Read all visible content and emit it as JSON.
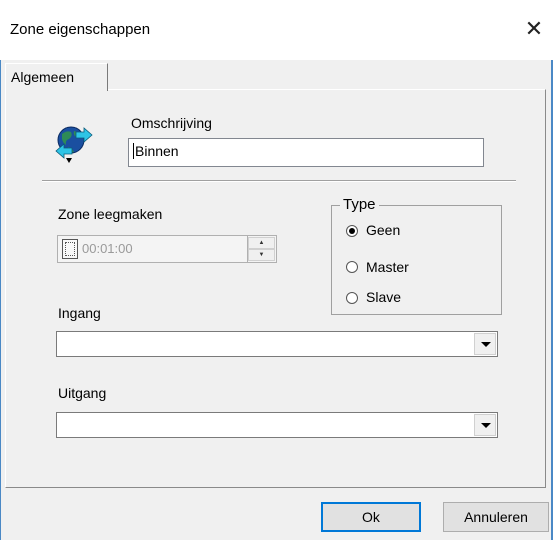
{
  "window": {
    "title": "Zone eigenschappen",
    "close_glyph": "✕"
  },
  "tabs": [
    {
      "label": "Algemeen",
      "selected": true
    }
  ],
  "general": {
    "icon": "globe-arrows-icon",
    "description_label": "Omschrijving",
    "description_value": "Binnen",
    "clear_zone_label": "Zone leegmaken",
    "clear_zone_checked": false,
    "clear_zone_time": "00:01:00",
    "type_group": {
      "label": "Type",
      "options": [
        {
          "label": "Geen",
          "selected": true
        },
        {
          "label": "Master",
          "selected": false
        },
        {
          "label": "Slave",
          "selected": false
        }
      ]
    },
    "input_label": "Ingang",
    "input_value": "",
    "output_label": "Uitgang",
    "output_value": ""
  },
  "buttons": {
    "ok": "Ok",
    "cancel": "Annuleren"
  },
  "colors": {
    "window_border": "#4a88c5",
    "default_button_border": "#0078d7",
    "dialog_bg": "#f0f0f0"
  }
}
